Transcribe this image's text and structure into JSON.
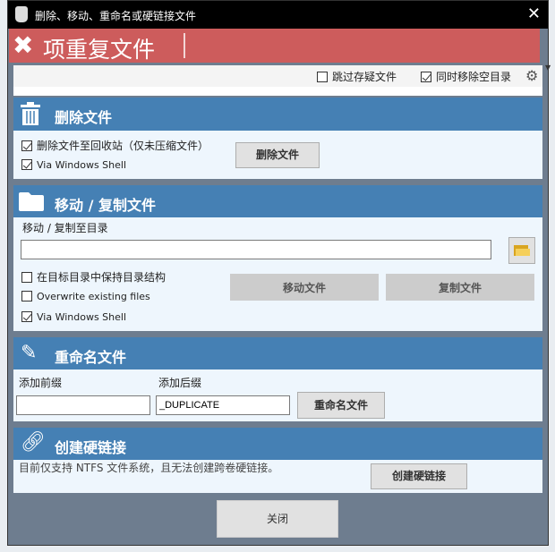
{
  "window": {
    "title": "删除、移动、重命名或硬链接文件",
    "close": "✕"
  },
  "banner": {
    "icon": "✖",
    "title": "项重复文件"
  },
  "options": {
    "skip_label": "跳过存疑文件",
    "skip_checked": false,
    "remove_empty_label": "同时移除空目录",
    "remove_empty_checked": true
  },
  "delete": {
    "title": "删除文件",
    "recycle_label": "删除文件至回收站（仅未压缩文件）",
    "recycle_checked": true,
    "shell_label": "Via Windows Shell",
    "shell_checked": true,
    "button": "删除文件"
  },
  "move": {
    "title": "移动 / 复制文件",
    "dest_label": "移动 / 复制至目录",
    "dest_value": "",
    "keep_structure_label": "在目标目录中保持目录结构",
    "keep_checked": false,
    "overwrite_label": "Overwrite existing files",
    "overwrite_checked": false,
    "shell_label": "Via Windows Shell",
    "shell_checked": true,
    "move_button": "移动文件",
    "copy_button": "复制文件"
  },
  "rename": {
    "title": "重命名文件",
    "prefix_label": "添加前缀",
    "prefix_value": "",
    "suffix_label": "添加后缀",
    "suffix_value": "_DUPLICATE",
    "button": "重命名文件"
  },
  "hardlink": {
    "title": "创建硬链接",
    "note": "目前仅支持 NTFS 文件系统，且无法创建跨卷硬链接。",
    "button": "创建硬链接"
  },
  "footer": {
    "close_button": "关闭"
  }
}
